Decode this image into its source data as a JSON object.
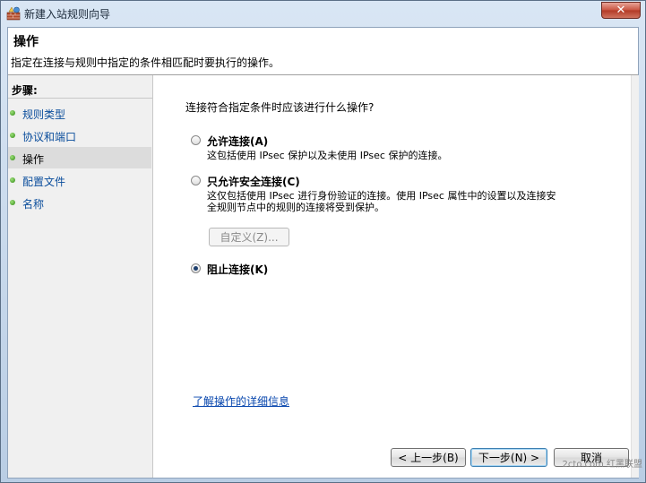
{
  "window": {
    "title": "新建入站规则向导",
    "close_label": "✕"
  },
  "header": {
    "title": "操作",
    "description": "指定在连接与规则中指定的条件相匹配时要执行的操作。"
  },
  "sidebar": {
    "steps_label": "步骤:",
    "items": [
      {
        "label": "规则类型"
      },
      {
        "label": "协议和端口"
      },
      {
        "label": "操作"
      },
      {
        "label": "配置文件"
      },
      {
        "label": "名称"
      }
    ]
  },
  "main": {
    "question": "连接符合指定条件时应该进行什么操作?",
    "options": [
      {
        "title": "允许连接(A)",
        "desc": [
          "这包括使用 IPsec 保护以及未使用 IPsec 保护的连接。"
        ],
        "checked": false
      },
      {
        "title": "只允许安全连接(C)",
        "desc": [
          "这仅包括使用 IPsec 进行身份验证的连接。使用 IPsec 属性中的设置以及连接安",
          "全规则节点中的规则的连接将受到保护。"
        ],
        "checked": false
      },
      {
        "title": "阻止连接(K)",
        "desc": [],
        "checked": true
      }
    ],
    "customize_label": "自定义(Z)...",
    "help_link": "了解操作的详细信息"
  },
  "footer": {
    "back_label": "< 上一步(B)",
    "next_label": "下一步(N) >",
    "cancel_label": "取消"
  },
  "watermark": "2cto.com 红黑联盟"
}
